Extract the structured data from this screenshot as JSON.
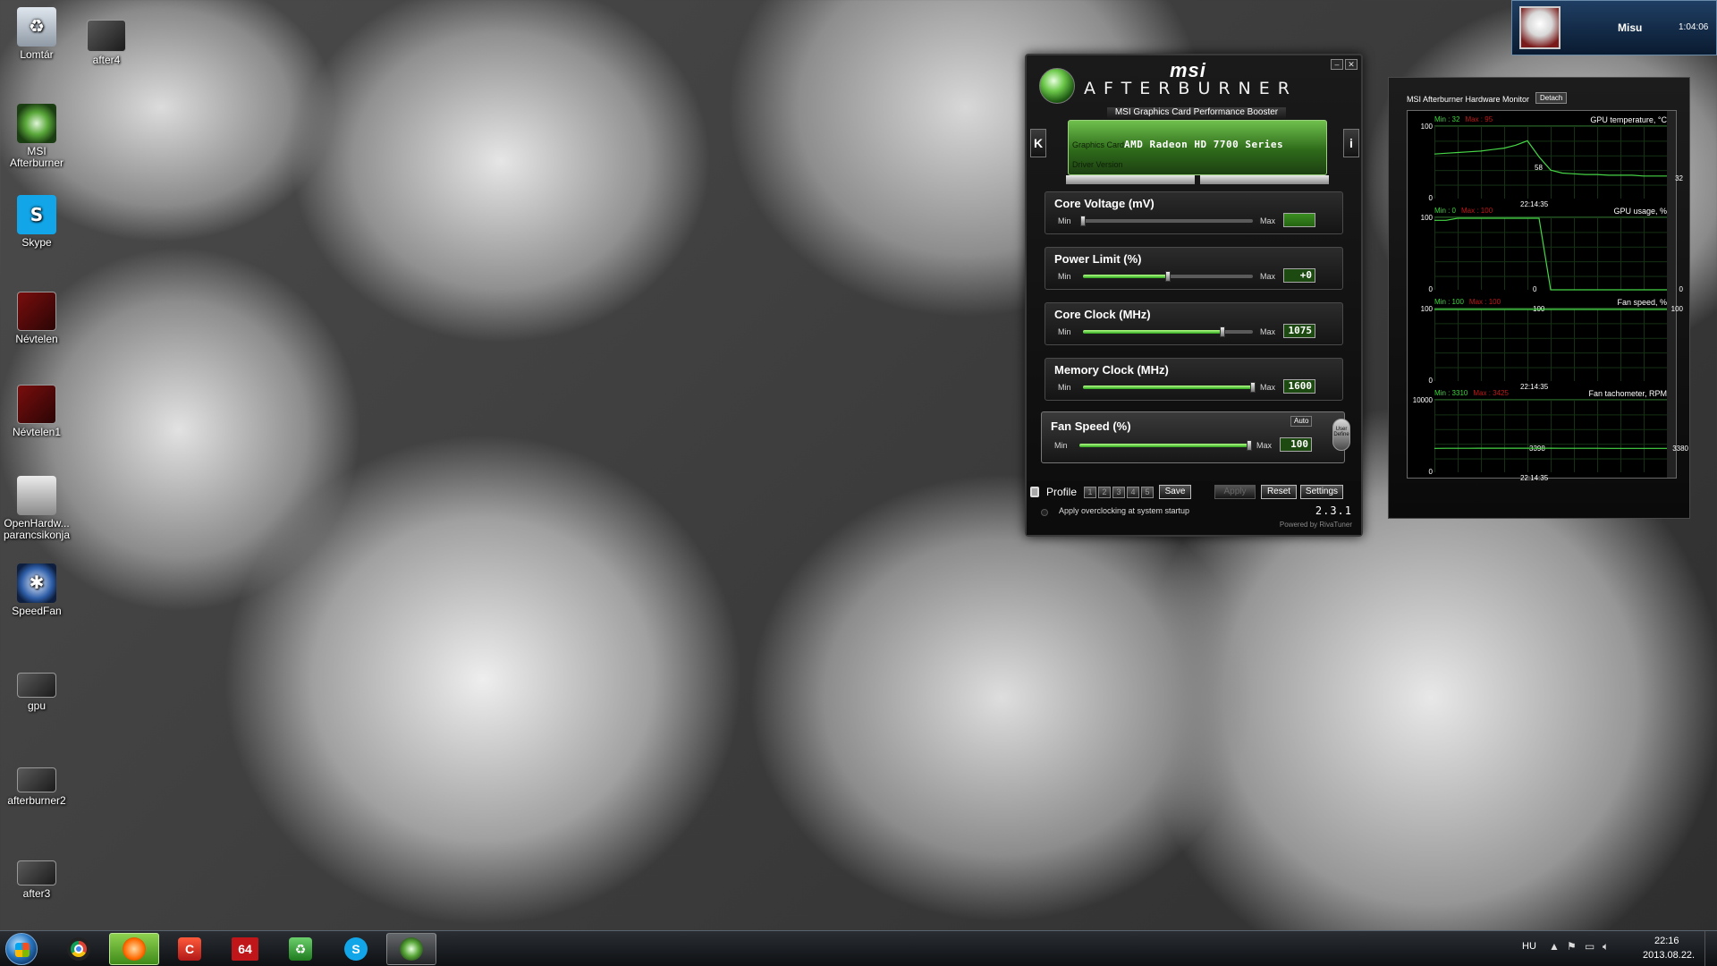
{
  "desktop": {
    "icons": [
      {
        "label": "Lomtár",
        "icon": "recycle-bin-icon"
      },
      {
        "label": "after4",
        "icon": "image-thumbnail-icon"
      },
      {
        "label": "MSI Afterburner",
        "icon": "afterburner-icon"
      },
      {
        "label": "Skype",
        "icon": "skype-icon"
      },
      {
        "label": "Névtelen",
        "icon": "image-thumbnail-icon"
      },
      {
        "label": "Névtelen1",
        "icon": "image-thumbnail-icon"
      },
      {
        "label": "OpenHardw... parancsikonja",
        "icon": "openhardwaremonitor-icon"
      },
      {
        "label": "SpeedFan",
        "icon": "speedfan-icon"
      },
      {
        "label": "gpu",
        "icon": "image-thumbnail-icon"
      },
      {
        "label": "afterburner2",
        "icon": "image-thumbnail-icon"
      },
      {
        "label": "after3",
        "icon": "image-thumbnail-icon"
      }
    ]
  },
  "afterburner": {
    "brand": "msi",
    "title": "AFTERBURNER",
    "subtitle": "MSI Graphics Card Performance Booster",
    "graphics_card_label": "Graphics Card",
    "graphics_card_value": "AMD Radeon HD 7700 Series",
    "driver_version_label": "Driver Version",
    "left_button": "K",
    "right_button": "i",
    "sliders": [
      {
        "label": "Core Voltage (mV)",
        "min": "Min",
        "max": "Max",
        "value": "",
        "fraction": 0.0
      },
      {
        "label": "Power Limit (%)",
        "min": "Min",
        "max": "Max",
        "value": "+0",
        "fraction": 0.5
      },
      {
        "label": "Core Clock (MHz)",
        "min": "Min",
        "max": "Max",
        "value": "1075",
        "fraction": 0.82
      },
      {
        "label": "Memory Clock (MHz)",
        "min": "Min",
        "max": "Max",
        "value": "1600",
        "fraction": 1.0
      },
      {
        "label": "Fan Speed (%)",
        "min": "Min",
        "max": "Max",
        "value": "100",
        "fraction": 1.0,
        "auto": "Auto"
      }
    ],
    "user_define": "User Define",
    "profile_label": "Profile",
    "profile_slots": [
      "1",
      "2",
      "3",
      "4",
      "5"
    ],
    "save_button": "Save",
    "apply_button": "Apply",
    "reset_button": "Reset",
    "settings_button": "Settings",
    "startup_label": "Apply overclocking at system startup",
    "version": "2.3.1",
    "powered_by": "Powered by RivaTuner"
  },
  "hardware_monitor": {
    "title": "MSI Afterburner Hardware Monitor",
    "detach_button": "Detach",
    "graphs": [
      {
        "name": "GPU temperature, °C",
        "min_label": "Min : 32",
        "max_label": "Max : 95",
        "axis_top": "100",
        "axis_bottom": "0",
        "time": "22:14:35",
        "current": "32",
        "peak_label": "58",
        "points": [
          62,
          63,
          64,
          65,
          66,
          68,
          70,
          74,
          80,
          58,
          40,
          36,
          35,
          34,
          34,
          33,
          33,
          33,
          32,
          32,
          32
        ]
      },
      {
        "name": "GPU usage, %",
        "min_label": "Min : 0",
        "max_label": "Max : 100",
        "axis_top": "100",
        "axis_bottom": "0",
        "time": "22:14:35",
        "current": "0",
        "mid_label": "0",
        "points": [
          96,
          96,
          100,
          100,
          100,
          100,
          100,
          100,
          100,
          100,
          0,
          0,
          0,
          0,
          0,
          0,
          0,
          0,
          0,
          0,
          0
        ]
      },
      {
        "name": "Fan speed, %",
        "min_label": "Min : 100",
        "max_label": "Max : 100",
        "axis_top": "100",
        "axis_bottom": "0",
        "time": "22:14:35",
        "current": "100",
        "mid_label": "100",
        "points": [
          100,
          100,
          100,
          100,
          100,
          100,
          100,
          100,
          100,
          100,
          100,
          100,
          100,
          100,
          100,
          100,
          100,
          100,
          100,
          100,
          100
        ]
      },
      {
        "name": "Fan tachometer, RPM",
        "min_label": "Min : 3310",
        "max_label": "Max : 3425",
        "axis_top": "10000",
        "axis_bottom": "0",
        "time": "22:14:35",
        "current": "3380",
        "mid_label": "3398",
        "points": [
          3380,
          3385,
          3390,
          3395,
          3398,
          3398,
          3398,
          3398,
          3398,
          3398,
          3398,
          3395,
          3390,
          3388,
          3385,
          3383,
          3382,
          3381,
          3380,
          3380,
          3380
        ]
      }
    ]
  },
  "user_tile": {
    "name": "Misu",
    "time": "1:04:06"
  },
  "taskbar": {
    "apps": [
      {
        "name": "chrome",
        "icon": "chrome-icon"
      },
      {
        "name": "app-orange",
        "icon": "orange-app-icon"
      },
      {
        "name": "ccleaner",
        "icon": "ccleaner-icon"
      },
      {
        "name": "aida64",
        "icon": "aida64-icon",
        "text": "64"
      },
      {
        "name": "recycle-tool",
        "icon": "recycle-tool-icon"
      },
      {
        "name": "skype",
        "icon": "skype-icon",
        "text": "S"
      },
      {
        "name": "afterburner",
        "icon": "afterburner-icon"
      }
    ],
    "language": "HU",
    "clock_time": "22:16",
    "clock_date": "2013.08.22."
  }
}
